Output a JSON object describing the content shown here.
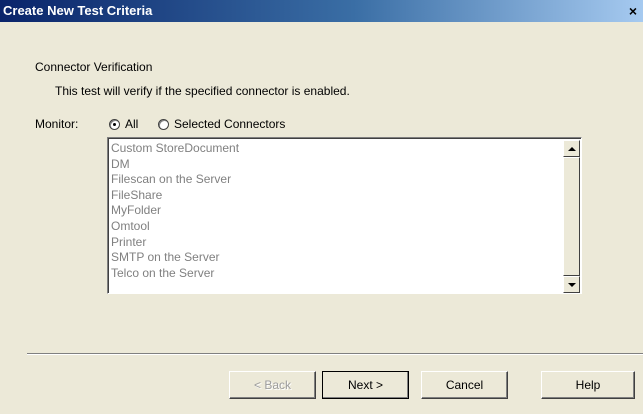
{
  "window": {
    "title": "Create New Test Criteria",
    "close_glyph": "×"
  },
  "section": {
    "heading": "Connector Verification",
    "description": "This test will verify if the specified connector is enabled."
  },
  "monitor": {
    "label": "Monitor:",
    "options": [
      {
        "label": "All",
        "checked": true
      },
      {
        "label": "Selected Connectors",
        "checked": false
      }
    ]
  },
  "connectors": {
    "items": [
      "Custom StoreDocument",
      "DM",
      "Filescan on the Server",
      "FileShare",
      "MyFolder",
      "Omtool",
      "Printer",
      "SMTP on the Server",
      "Telco on the Server"
    ],
    "disabled": true
  },
  "buttons": {
    "back": "< Back",
    "next": "Next >",
    "cancel": "Cancel",
    "help": "Help"
  },
  "colors": {
    "title_bar_start": "#0a246a",
    "title_bar_end": "#a6caf0",
    "dialog_background": "#ece9d8",
    "disabled_text": "#808080"
  }
}
